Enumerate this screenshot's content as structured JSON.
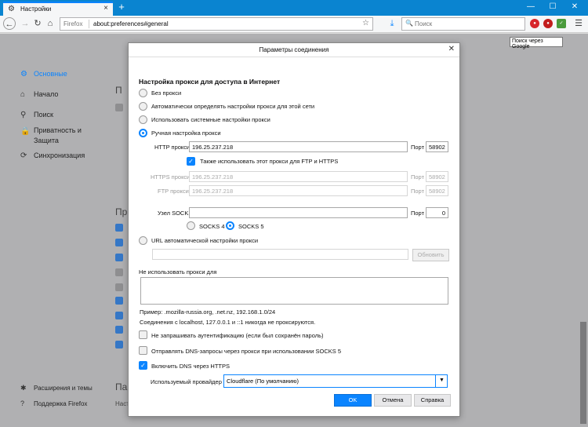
{
  "browser": {
    "tab_label": "Настройки",
    "new_tab": "+",
    "url_brand": "Firefox",
    "url": "about:preferences#general",
    "search_placeholder": "Поиск",
    "tooltip": "Поиск через Google",
    "win_min": "—",
    "win_max": "☐",
    "win_close": "✕"
  },
  "sidebar": {
    "items": [
      {
        "label": "Основные"
      },
      {
        "label": "Начало"
      },
      {
        "label": "Поиск"
      },
      {
        "label": "Приватность и"
      },
      {
        "label": "Защита"
      },
      {
        "label": "Синхронизация"
      }
    ],
    "footer": [
      {
        "label": "Расширения и темы"
      },
      {
        "label": "Поддержка Firefox"
      }
    ],
    "accent": "#0a84ff"
  },
  "background": {
    "frag1": "П",
    "frag2": "Пр",
    "frag3": "Пар",
    "frag4": "Наст"
  },
  "dialog": {
    "title": "Параметры соединения",
    "section_title": "Настройка прокси для доступа в Интернет",
    "options": {
      "no_proxy": "Без прокси",
      "auto_detect": "Автоматически определять настройки прокси для этой сети",
      "system": "Использовать системные настройки прокси",
      "manual": "Ручная настройка прокси",
      "pac": "URL автоматической настройки прокси"
    },
    "http_label": "HTTP прокси",
    "http_value": "196.25.237.218",
    "port_label": "Порт",
    "http_port": "58902",
    "also_use": "Также использовать этот прокси для FTP и HTTPS",
    "https_label": "HTTPS прокси",
    "https_value": "196.25.237.218",
    "https_port": "58902",
    "ftp_label": "FTP прокси",
    "ftp_value": "196.25.237.218",
    "ftp_port": "58902",
    "socks_label": "Узел SOCKS",
    "socks_value": "",
    "socks_port": "0",
    "socks4": "SOCKS 4",
    "socks5": "SOCKS 5",
    "pac_value": "",
    "reload": "Обновить",
    "no_proxy_for": "Не использовать прокси для",
    "no_proxy_value": "",
    "example": "Пример: .mozilla-russia.org, .net.nz, 192.168.1.0/24",
    "localhost_note": "Соединения с localhost, 127.0.0.1 и ::1 никогда не проксируются.",
    "no_prompt_auth": "Не запрашивать аутентификацию (если был сохранён пароль)",
    "socks_dns": "Отправлять DNS-запросы через прокси при использовании SOCKS 5",
    "dns_https": "Включить DNS через HTTPS",
    "provider_label": "Используемый провайдер",
    "provider_value": "Cloudflare (По умолчанию)",
    "ok": "OK",
    "cancel": "Отмена",
    "help": "Справка"
  }
}
